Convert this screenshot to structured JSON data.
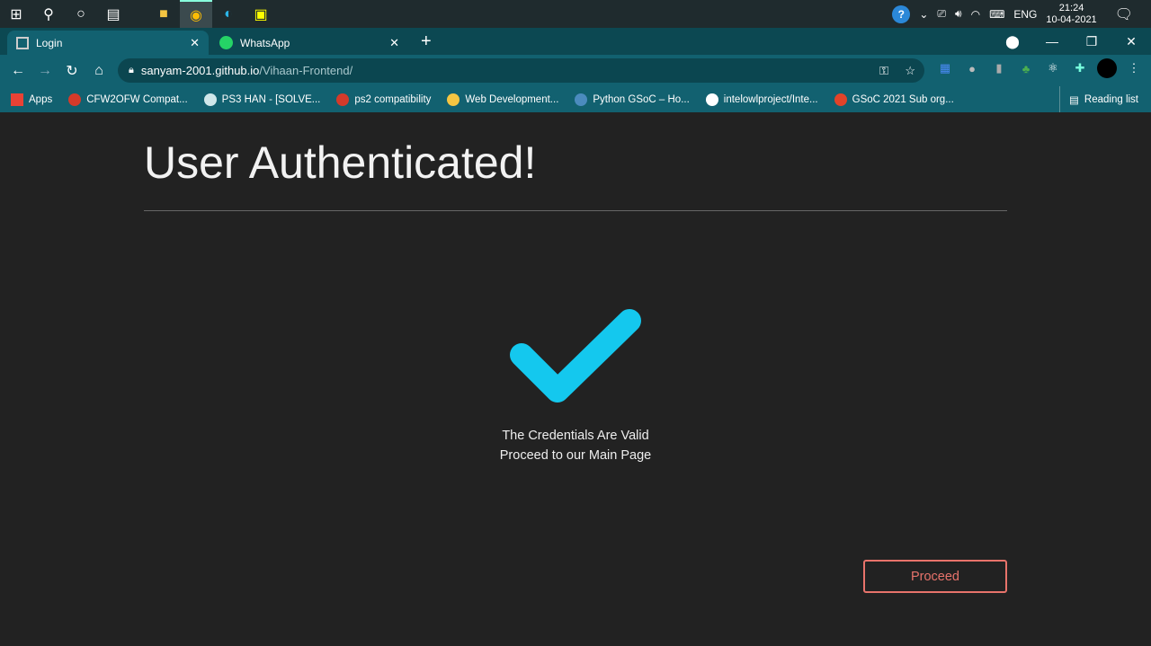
{
  "taskbar": {
    "time": "21:24",
    "date": "10-04-2021",
    "lang": "ENG"
  },
  "tabs": [
    {
      "label": "Login",
      "active": true
    },
    {
      "label": "WhatsApp",
      "active": false
    }
  ],
  "address": {
    "host": "sanyam-2001.github.io",
    "path": "/Vihaan-Frontend/"
  },
  "bookmarks": [
    {
      "label": "Apps",
      "color": "#e94235"
    },
    {
      "label": "CFW2OFW Compat...",
      "color": "#d43a2a"
    },
    {
      "label": "PS3 HAN - [SOLVE...",
      "color": "#cfe7ea"
    },
    {
      "label": "ps2 compatibility",
      "color": "#d43a2a"
    },
    {
      "label": "Web Development...",
      "color": "#f5c542"
    },
    {
      "label": "Python GSoC – Ho...",
      "color": "#4b8bbe"
    },
    {
      "label": "intelowlproject/Inte...",
      "color": "#ffffff"
    },
    {
      "label": "GSoC 2021 Sub org...",
      "color": "#e24329"
    }
  ],
  "reading_list": "Reading list",
  "page": {
    "title": "User Authenticated!",
    "line1": "The Credentials Are Valid",
    "line2": "Proceed to our Main Page",
    "button": "Proceed"
  },
  "colors": {
    "check": "#14c8ee",
    "button": "#e8736b"
  }
}
